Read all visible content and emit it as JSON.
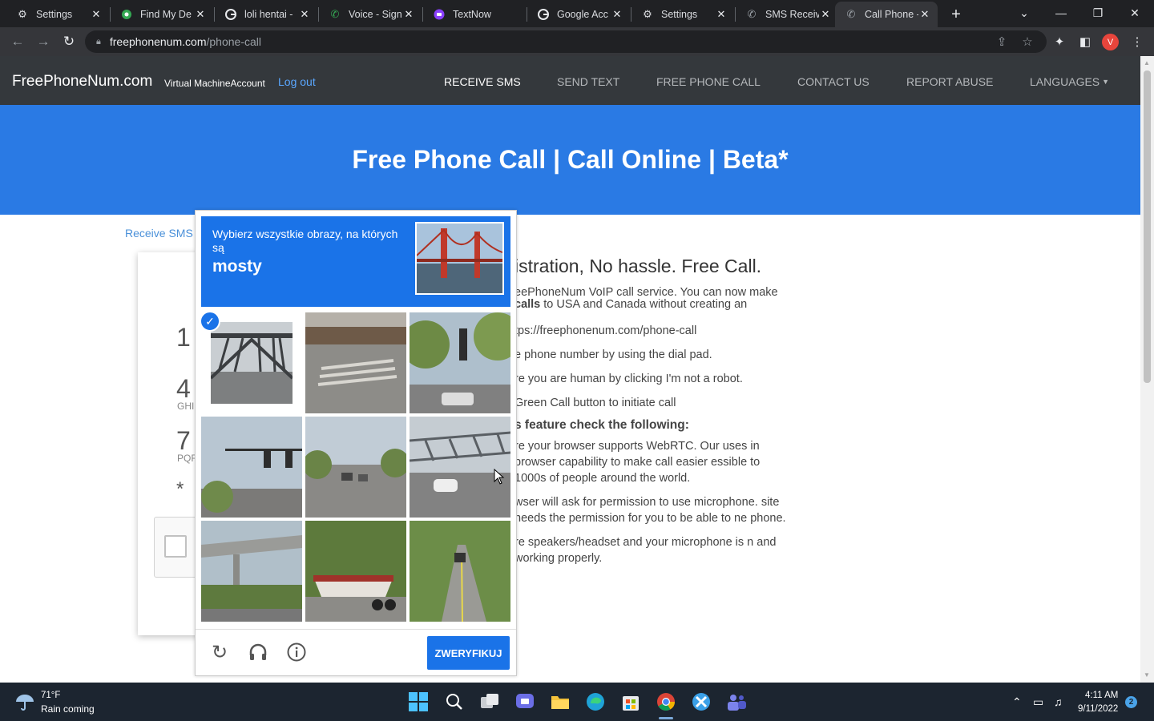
{
  "tabs": [
    {
      "label": "Settings",
      "icon": "gear-icon"
    },
    {
      "label": "Find My De",
      "icon": "find-device-icon"
    },
    {
      "label": "loli hentai -",
      "icon": "google-icon"
    },
    {
      "label": "Voice - Sign",
      "icon": "voice-icon"
    },
    {
      "label": "TextNow",
      "icon": "textnow-icon"
    },
    {
      "label": "Google Acc",
      "icon": "google-icon"
    },
    {
      "label": "Settings",
      "icon": "gear-icon"
    },
    {
      "label": "SMS Receiv",
      "icon": "phone-icon"
    },
    {
      "label": "Call Phone -",
      "icon": "phone-icon",
      "active": true
    }
  ],
  "address_bar": {
    "host": "freephonenum.com",
    "path": "/phone-call"
  },
  "profile_initial": "V",
  "site": {
    "brand": "FreePhoneNum.com",
    "brand_sub": "Virtual MachineAccount",
    "logout": "Log out",
    "nav": [
      "RECEIVE SMS",
      "SEND TEXT",
      "FREE PHONE CALL",
      "CONTACT US",
      "REPORT ABUSE",
      "LANGUAGES"
    ],
    "hero_title": "Free Phone Call | Call Online | Beta*",
    "breadcrumb": "Receive SMS",
    "dialer_keys": [
      {
        "key": "1",
        "sub": ""
      },
      {
        "key": "4",
        "sub": "GHI"
      },
      {
        "key": "7",
        "sub": "PQR"
      },
      {
        "key": "*",
        "sub": ""
      }
    ],
    "content": {
      "heading": "istration, No hassle. Free Call.",
      "intro_a": "eePhoneNum VoIP call service. You can now make",
      "intro_b_bold": "calls",
      "intro_b": " to USA and Canada without creating an",
      "step1": "tps://freephonenum.com/phone-call",
      "step2": "e phone number by using the dial pad.",
      "step3": "re you are human by clicking I'm not a robot.",
      "step4": "Green Call button to initiate call",
      "check_heading": "s feature check the following:",
      "check1": "re your browser supports WebRTC. Our uses in browser capability to make call easier essible to 1000s of people around the world.",
      "check2": "wser will ask for permission to use microphone. site needs the permission for you to be able to ne phone.",
      "check3": "re speakers/headset and your microphone is n and working properly."
    }
  },
  "captcha": {
    "instruction": "Wybierz wszystkie obrazy, na których są",
    "target_word": "mosty",
    "verify_label": "ZWERYFIKUJ",
    "tiles": [
      {
        "subject": "bridge-truss",
        "selected": true
      },
      {
        "subject": "crosswalk-street",
        "selected": false
      },
      {
        "subject": "traffic-light-trees",
        "selected": false
      },
      {
        "subject": "traffic-light-intersection",
        "selected": false
      },
      {
        "subject": "road-cars",
        "selected": false
      },
      {
        "subject": "bridge-truss-car",
        "selected": false
      },
      {
        "subject": "overpass",
        "selected": false
      },
      {
        "subject": "boat-trailer",
        "selected": false
      },
      {
        "subject": "tree-lined-road",
        "selected": false
      }
    ]
  },
  "taskbar": {
    "temp": "71°F",
    "weather": "Rain coming",
    "time": "4:11 AM",
    "date": "9/11/2022",
    "notifications": "2"
  }
}
